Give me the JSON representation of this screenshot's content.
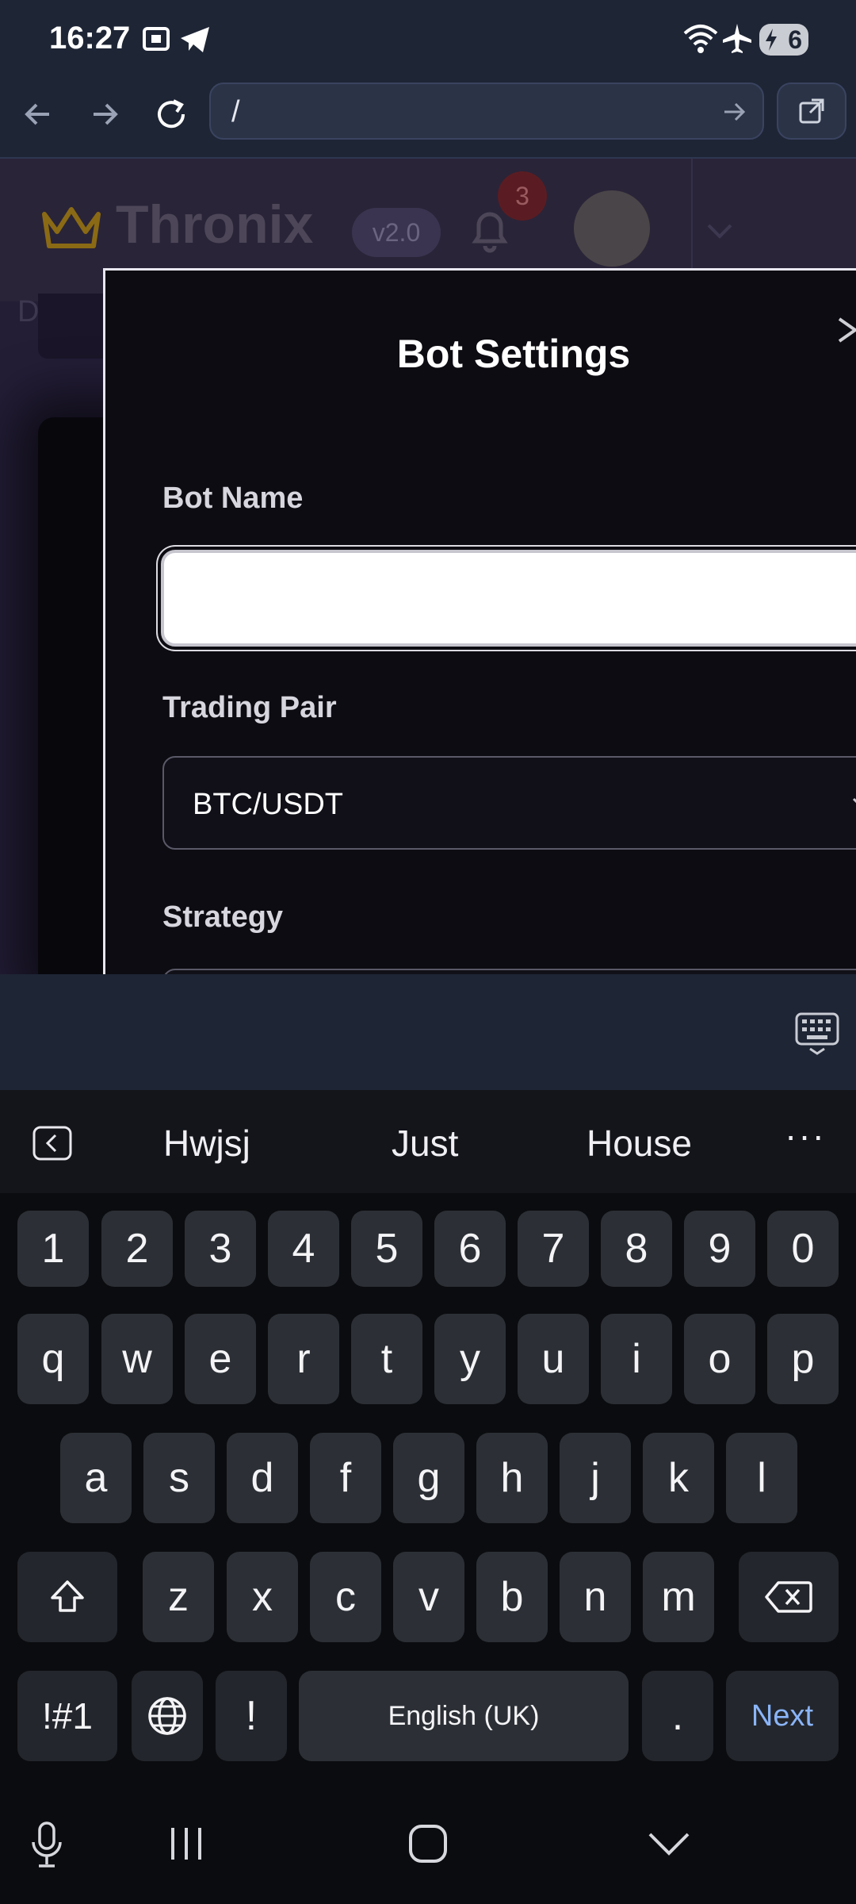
{
  "status_bar": {
    "time": "16:27",
    "battery": "6"
  },
  "browser": {
    "url": "/"
  },
  "app": {
    "logo": "Thronix",
    "version": "v2.0",
    "notifications": "3",
    "dashboard_label": "Dashb"
  },
  "modal": {
    "title": "Bot Settings",
    "bot_name_label": "Bot Name",
    "bot_name_value": "",
    "trading_pair_label": "Trading Pair",
    "trading_pair_value": "BTC/USDT",
    "strategy_label": "Strategy"
  },
  "keyboard": {
    "suggestions": [
      "Hwjsj",
      "Just",
      "House"
    ],
    "number_row": [
      "1",
      "2",
      "3",
      "4",
      "5",
      "6",
      "7",
      "8",
      "9",
      "0"
    ],
    "row1": [
      "q",
      "w",
      "e",
      "r",
      "t",
      "y",
      "u",
      "i",
      "o",
      "p"
    ],
    "row2": [
      "a",
      "s",
      "d",
      "f",
      "g",
      "h",
      "j",
      "k",
      "l"
    ],
    "row3": [
      "z",
      "x",
      "c",
      "v",
      "b",
      "n",
      "m"
    ],
    "symbols_label": "!#1",
    "exclaim_label": "!",
    "space_label": "English (UK)",
    "period_label": ".",
    "next_label": "Next"
  },
  "colors": {
    "accent": "#8ab4f8",
    "crown": "#8a6a14",
    "badge": "#5a1c22"
  }
}
